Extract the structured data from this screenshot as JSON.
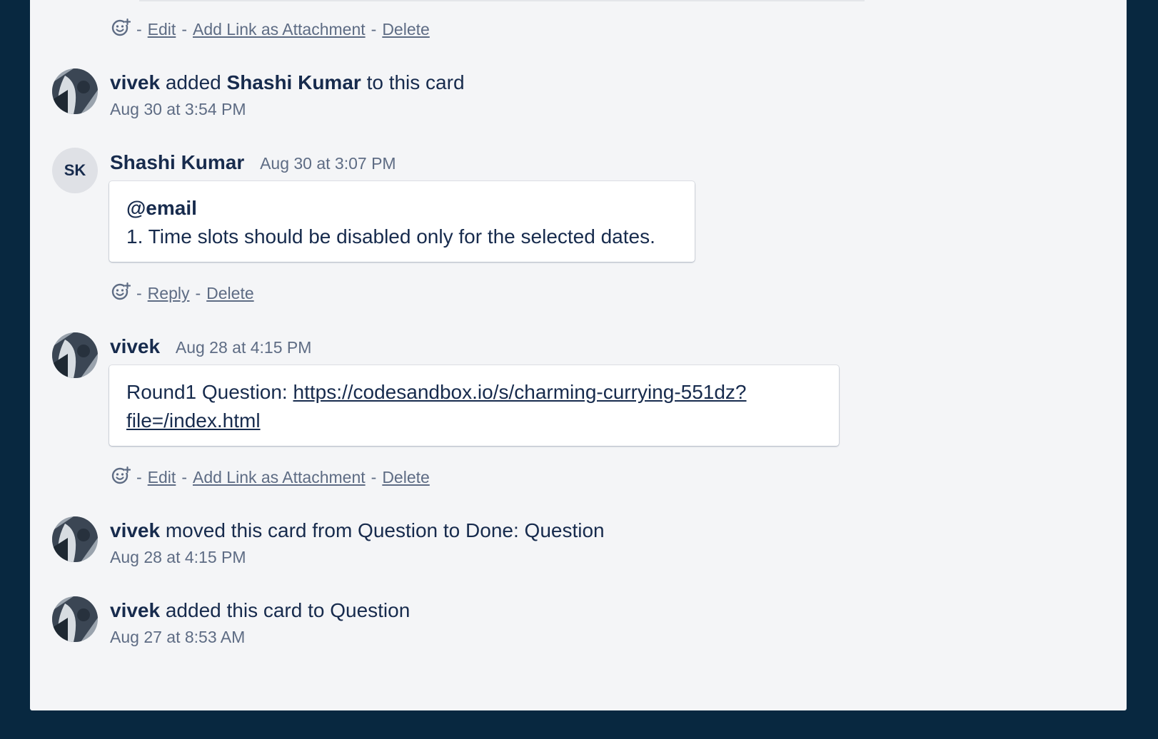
{
  "colors": {
    "background": "#082840",
    "panel": "#f4f5f7",
    "text": "#172b4d",
    "muted": "#5e6c84"
  },
  "activity": {
    "top_actions": {
      "react_icon": "add-reaction-icon",
      "edit": "Edit",
      "add_link": "Add Link as Attachment",
      "delete": "Delete"
    },
    "event1": {
      "actor": "vivek",
      "verb": "added",
      "target": "Shashi Kumar",
      "rest": "to this card",
      "timestamp": "Aug 30 at 3:54 PM"
    },
    "comment1": {
      "initials": "SK",
      "author": "Shashi Kumar",
      "timestamp": "Aug 30 at 3:07 PM",
      "mention": "@email",
      "body": "1. Time slots should be disabled only for the selected dates.",
      "reply": "Reply",
      "delete": "Delete"
    },
    "comment2": {
      "author": "vivek",
      "timestamp": "Aug 28 at 4:15 PM",
      "prefix": "Round1 Question: ",
      "link_line1": "https://codesandbox.io/s/charming-currying-551dz?",
      "link_line2": "file=/index.html",
      "edit": "Edit",
      "add_link": "Add Link as Attachment",
      "delete": "Delete"
    },
    "event2": {
      "actor": "vivek",
      "rest": "moved this card from Question to Done: Question",
      "timestamp": "Aug 28 at 4:15 PM"
    },
    "event3": {
      "actor": "vivek",
      "rest": "added this card to Question",
      "timestamp": "Aug 27 at 8:53 AM"
    }
  }
}
